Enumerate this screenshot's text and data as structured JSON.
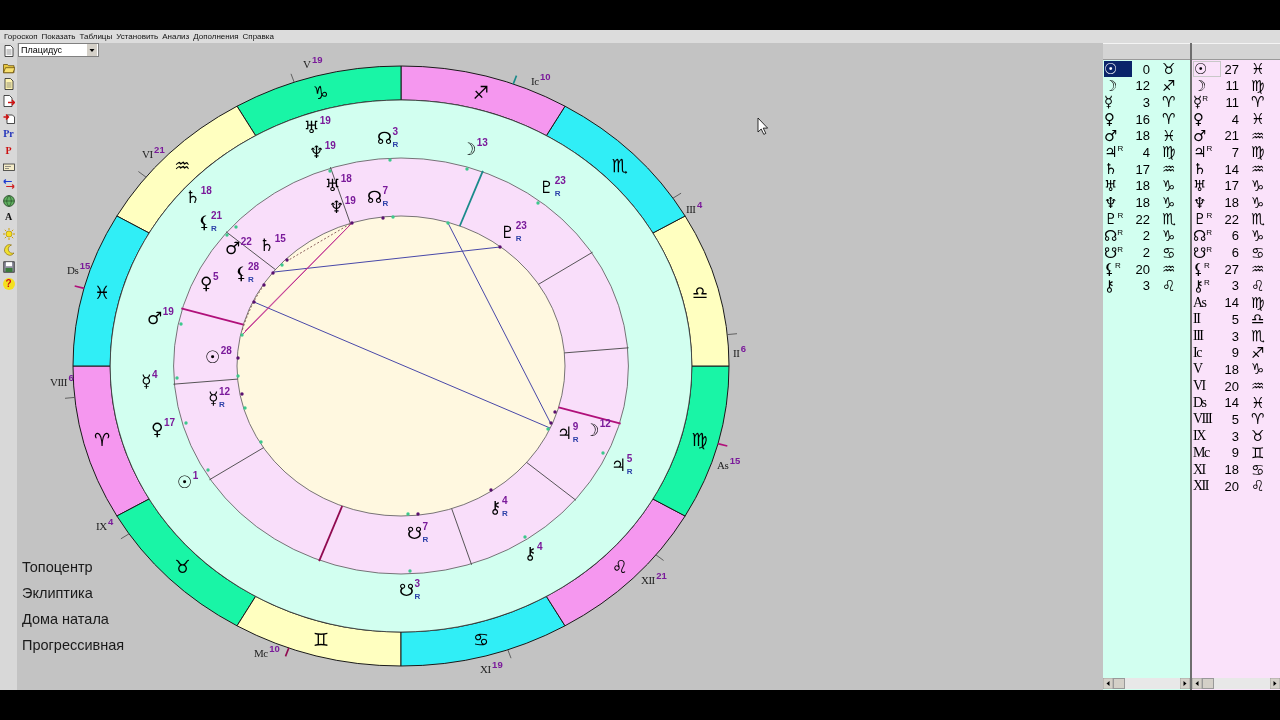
{
  "menu": [
    "Гороскоп",
    "Показать",
    "Таблицы",
    "Установить",
    "Анализ",
    "Дополнения",
    "Справка"
  ],
  "toolbar": [
    {
      "kind": "icon"
    },
    {
      "kind": "icon"
    },
    {
      "kind": "icon"
    },
    {
      "kind": "icon"
    },
    {
      "kind": "icon"
    },
    {
      "kind": "text",
      "label": "Pr",
      "color": "#2233bb"
    },
    {
      "kind": "text",
      "label": "P",
      "color": "#cc1111"
    },
    {
      "kind": "icon"
    },
    {
      "kind": "icon"
    },
    {
      "kind": "icon"
    },
    {
      "kind": "text",
      "label": "A",
      "color": "#111111"
    },
    {
      "kind": "icon"
    },
    {
      "kind": "icon"
    },
    {
      "kind": "icon"
    },
    {
      "kind": "disc",
      "label": "?"
    }
  ],
  "house_system": {
    "value": "Плацидус"
  },
  "chart": {
    "signs": [
      {
        "glyph": "♈",
        "color": "#f597ef"
      },
      {
        "glyph": "♉",
        "color": "#19f5a6"
      },
      {
        "glyph": "♊",
        "color": "#ffffc0"
      },
      {
        "glyph": "♋",
        "color": "#30eef6"
      },
      {
        "glyph": "♌",
        "color": "#f597ef"
      },
      {
        "glyph": "♍",
        "color": "#19f5a6"
      },
      {
        "glyph": "♎",
        "color": "#ffffc0"
      },
      {
        "glyph": "♏",
        "color": "#30eef6"
      },
      {
        "glyph": "♐",
        "color": "#f597ef"
      },
      {
        "glyph": "♑",
        "color": "#19f5a6"
      },
      {
        "glyph": "♒",
        "color": "#ffffc0"
      },
      {
        "glyph": "♓",
        "color": "#30eef6"
      }
    ],
    "house_labels": [
      {
        "kind": "angle",
        "label": "As",
        "degree": "15"
      },
      {
        "kind": "house",
        "label": "II",
        "degree": "6"
      },
      {
        "kind": "house",
        "label": "III",
        "degree": "4"
      },
      {
        "kind": "angle",
        "label": "Ic",
        "degree": "10"
      },
      {
        "kind": "house",
        "label": "V",
        "degree": "19"
      },
      {
        "kind": "house",
        "label": "VI",
        "degree": "21"
      },
      {
        "kind": "angle",
        "label": "Ds",
        "degree": "15"
      },
      {
        "kind": "house",
        "label": "VIII",
        "degree": "6"
      },
      {
        "kind": "house",
        "label": "IX",
        "degree": "4"
      },
      {
        "kind": "angle",
        "label": "Mc",
        "degree": "10"
      },
      {
        "kind": "house",
        "label": "XI",
        "degree": "19"
      },
      {
        "kind": "house",
        "label": "XII",
        "degree": "21"
      }
    ],
    "outer_ring_planets": [
      {
        "glyph": "♅",
        "degree": "19"
      },
      {
        "glyph": "☊",
        "degree": "3",
        "retro": "R"
      },
      {
        "glyph": "☽",
        "degree": "13"
      },
      {
        "glyph": "♆",
        "degree": "19"
      },
      {
        "glyph": "♇",
        "degree": "23",
        "retro": "R"
      },
      {
        "glyph": "♄",
        "degree": "18"
      },
      {
        "glyph": "⚸",
        "degree": "21",
        "retro": "R"
      },
      {
        "glyph": "♂",
        "degree": "19"
      },
      {
        "glyph": "☿",
        "degree": "4"
      },
      {
        "glyph": "♀",
        "degree": "17"
      },
      {
        "glyph": "♃",
        "degree": "5",
        "retro": "R"
      },
      {
        "glyph": "☉",
        "degree": "1"
      },
      {
        "glyph": "⚷",
        "degree": "4"
      },
      {
        "glyph": "☋",
        "degree": "3",
        "retro": "R"
      }
    ],
    "inner_ring_planets": [
      {
        "glyph": "♅",
        "degree": "18"
      },
      {
        "glyph": "☊",
        "degree": "7",
        "retro": "R"
      },
      {
        "glyph": "♆",
        "degree": "19"
      },
      {
        "glyph": "♇",
        "degree": "23",
        "retro": "R"
      },
      {
        "glyph": "♂",
        "degree": "22"
      },
      {
        "glyph": "♄",
        "degree": "15"
      },
      {
        "glyph": "⚸",
        "degree": "28",
        "retro": "R"
      },
      {
        "glyph": "♀",
        "degree": "5"
      },
      {
        "glyph": "☉",
        "degree": "28"
      },
      {
        "glyph": "☿",
        "degree": "12",
        "retro": "R"
      },
      {
        "glyph": "☽",
        "degree": "12"
      },
      {
        "glyph": "♃",
        "degree": "9",
        "retro": "R"
      },
      {
        "glyph": "⚷",
        "degree": "4",
        "retro": "R"
      },
      {
        "glyph": "☋",
        "degree": "7",
        "retro": "R"
      }
    ],
    "options": [
      "Топоцентр",
      "Эклиптика",
      "Дома натала",
      "Прогрессивная"
    ]
  },
  "left_table": {
    "focused": true,
    "rows": [
      {
        "kind": "planet",
        "glyph": "☉",
        "degree": "0",
        "sign": "♉",
        "selected": true
      },
      {
        "kind": "planet",
        "glyph": "☽",
        "degree": "12",
        "sign": "♐",
        "selected": false
      },
      {
        "kind": "planet",
        "glyph": "☿",
        "degree": "3",
        "sign": "♈",
        "selected": false
      },
      {
        "kind": "planet",
        "glyph": "♀",
        "degree": "16",
        "sign": "♈",
        "selected": false
      },
      {
        "kind": "planet",
        "glyph": "♂",
        "degree": "18",
        "sign": "♓",
        "selected": false
      },
      {
        "kind": "planet",
        "glyph": "♃",
        "retro": "R",
        "degree": "4",
        "sign": "♍",
        "selected": false
      },
      {
        "kind": "planet",
        "glyph": "♄",
        "degree": "17",
        "sign": "♒",
        "selected": false
      },
      {
        "kind": "planet",
        "glyph": "♅",
        "degree": "18",
        "sign": "♑",
        "selected": false
      },
      {
        "kind": "planet",
        "glyph": "♆",
        "degree": "18",
        "sign": "♑",
        "selected": false
      },
      {
        "kind": "planet",
        "glyph": "♇",
        "retro": "R",
        "degree": "22",
        "sign": "♏",
        "selected": false
      },
      {
        "kind": "planet",
        "glyph": "☊",
        "retro": "R",
        "degree": "2",
        "sign": "♑",
        "selected": false
      },
      {
        "kind": "planet",
        "glyph": "☋",
        "retro": "R",
        "degree": "2",
        "sign": "♋",
        "selected": false
      },
      {
        "kind": "planet",
        "glyph": "⚸",
        "retro": "R",
        "degree": "20",
        "sign": "♒",
        "selected": false
      },
      {
        "kind": "planet",
        "glyph": "⚷",
        "degree": "3",
        "sign": "♌",
        "selected": false
      }
    ]
  },
  "right_table": {
    "focused": false,
    "rows": [
      {
        "kind": "planet",
        "glyph": "☉",
        "degree": "27",
        "sign": "♓",
        "selected": true
      },
      {
        "kind": "planet",
        "glyph": "☽",
        "degree": "11",
        "sign": "♍",
        "selected": false
      },
      {
        "kind": "planet",
        "glyph": "☿",
        "retro": "R",
        "degree": "11",
        "sign": "♈",
        "selected": false
      },
      {
        "kind": "planet",
        "glyph": "♀",
        "degree": "4",
        "sign": "♓",
        "selected": false
      },
      {
        "kind": "planet",
        "glyph": "♂",
        "degree": "21",
        "sign": "♒",
        "selected": false
      },
      {
        "kind": "planet",
        "glyph": "♃",
        "retro": "R",
        "degree": "7",
        "sign": "♍",
        "selected": false
      },
      {
        "kind": "planet",
        "glyph": "♄",
        "degree": "14",
        "sign": "♒",
        "selected": false
      },
      {
        "kind": "planet",
        "glyph": "♅",
        "degree": "17",
        "sign": "♑",
        "selected": false
      },
      {
        "kind": "planet",
        "glyph": "♆",
        "degree": "18",
        "sign": "♑",
        "selected": false
      },
      {
        "kind": "planet",
        "glyph": "♇",
        "retro": "R",
        "degree": "22",
        "sign": "♏",
        "selected": false
      },
      {
        "kind": "planet",
        "glyph": "☊",
        "retro": "R",
        "degree": "6",
        "sign": "♑",
        "selected": false
      },
      {
        "kind": "planet",
        "glyph": "☋",
        "retro": "R",
        "degree": "6",
        "sign": "♋",
        "selected": false
      },
      {
        "kind": "planet",
        "glyph": "⚸",
        "retro": "R",
        "degree": "27",
        "sign": "♒",
        "selected": false
      },
      {
        "kind": "planet",
        "glyph": "⚷",
        "retro": "R",
        "degree": "3",
        "sign": "♌",
        "selected": false
      },
      {
        "kind": "house",
        "glyph": "As",
        "degree": "14",
        "sign": "♍",
        "selected": false
      },
      {
        "kind": "house",
        "glyph": "II",
        "degree": "5",
        "sign": "♎",
        "selected": false
      },
      {
        "kind": "house",
        "glyph": "III",
        "degree": "3",
        "sign": "♏",
        "selected": false
      },
      {
        "kind": "house",
        "glyph": "Ic",
        "degree": "9",
        "sign": "♐",
        "selected": false
      },
      {
        "kind": "house",
        "glyph": "V",
        "degree": "18",
        "sign": "♑",
        "selected": false
      },
      {
        "kind": "house",
        "glyph": "VI",
        "degree": "20",
        "sign": "♒",
        "selected": false
      },
      {
        "kind": "house",
        "glyph": "Ds",
        "degree": "14",
        "sign": "♓",
        "selected": false
      },
      {
        "kind": "house",
        "glyph": "VIII",
        "degree": "5",
        "sign": "♈",
        "selected": false
      },
      {
        "kind": "house",
        "glyph": "IX",
        "degree": "3",
        "sign": "♉",
        "selected": false
      },
      {
        "kind": "house",
        "glyph": "Mc",
        "degree": "9",
        "sign": "♊",
        "selected": false
      },
      {
        "kind": "house",
        "glyph": "XI",
        "degree": "18",
        "sign": "♋",
        "selected": false
      },
      {
        "kind": "house",
        "glyph": "XII",
        "degree": "20",
        "sign": "♌",
        "selected": false
      }
    ]
  }
}
